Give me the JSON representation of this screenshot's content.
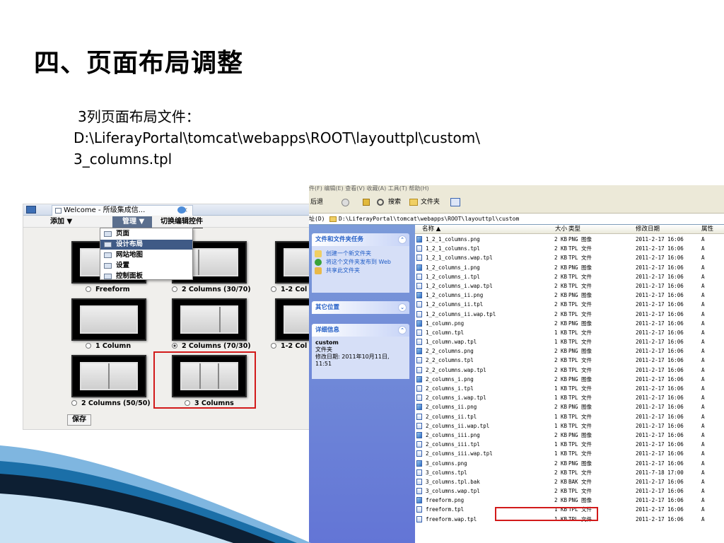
{
  "slide": {
    "title": "四、页面布局调整",
    "caption_line1": "3列页面布局文件：",
    "caption_line2": "D:\\LiferayPortal\\tomcat\\webapps\\ROOT\\layouttpl\\custom\\",
    "caption_line3": "3_columns.tpl"
  },
  "left_screenshot": {
    "tab_title": "Welcome - 所级集成信...",
    "tab_close": "×",
    "add_label": "添加 ▼",
    "manage_label": "管理 ▼",
    "toggle_label": "切换编辑控件",
    "menu_items": [
      "页面",
      "设计布局",
      "网站地图",
      "设置",
      "控制面板"
    ],
    "layouts": [
      {
        "label": "Freeform",
        "selected": false
      },
      {
        "label": "2 Columns (30/70)",
        "selected": false
      },
      {
        "label": "1-2 Col",
        "selected": false
      },
      {
        "label": "1 Column",
        "selected": false
      },
      {
        "label": "2 Columns (70/30)",
        "selected": true
      },
      {
        "label": "1-2 Col",
        "selected": false
      },
      {
        "label": "2 Columns (50/50)",
        "selected": false
      },
      {
        "label": "3 Columns",
        "selected": false
      }
    ],
    "save_label": "保存"
  },
  "explorer": {
    "menubar": "件(F)   编辑(E)   查看(V)   收藏(A)   工具(T)   帮助(H)",
    "back_label": "后退",
    "search_label": "搜索",
    "folders_label": "文件夹",
    "address_prefix": "址(D)",
    "address": "D:\\LiferayPortal\\tomcat\\webapps\\ROOT\\layouttpl\\custom",
    "tasks_header": "文件和文件夹任务",
    "tasks": [
      "创建一个新文件夹",
      "将这个文件夹发布到 Web",
      "共享此文件夹"
    ],
    "other_places_header": "其它位置",
    "details_header": "详细信息",
    "details_name": "custom",
    "details_type": "文件夹",
    "details_modified": "修改日期: 2011年10月11日, 11:51",
    "columns": {
      "name": "名称 ▲",
      "size": "大小",
      "type": "类型",
      "date": "修改日期",
      "attr": "属性"
    },
    "files": [
      {
        "name": "1_2_1_columns.png",
        "size": "2 KB",
        "type": "PNG 图像",
        "date": "2011-2-17 16:06",
        "attr": "A"
      },
      {
        "name": "1_2_1_columns.tpl",
        "size": "2 KB",
        "type": "TPL 文件",
        "date": "2011-2-17 16:06",
        "attr": "A"
      },
      {
        "name": "1_2_1_columns.wap.tpl",
        "size": "2 KB",
        "type": "TPL 文件",
        "date": "2011-2-17 16:06",
        "attr": "A"
      },
      {
        "name": "1_2_columns_i.png",
        "size": "2 KB",
        "type": "PNG 图像",
        "date": "2011-2-17 16:06",
        "attr": "A"
      },
      {
        "name": "1_2_columns_i.tpl",
        "size": "2 KB",
        "type": "TPL 文件",
        "date": "2011-2-17 16:06",
        "attr": "A"
      },
      {
        "name": "1_2_columns_i.wap.tpl",
        "size": "2 KB",
        "type": "TPL 文件",
        "date": "2011-2-17 16:06",
        "attr": "A"
      },
      {
        "name": "1_2_columns_ii.png",
        "size": "2 KB",
        "type": "PNG 图像",
        "date": "2011-2-17 16:06",
        "attr": "A"
      },
      {
        "name": "1_2_columns_ii.tpl",
        "size": "2 KB",
        "type": "TPL 文件",
        "date": "2011-2-17 16:06",
        "attr": "A"
      },
      {
        "name": "1_2_columns_ii.wap.tpl",
        "size": "2 KB",
        "type": "TPL 文件",
        "date": "2011-2-17 16:06",
        "attr": "A"
      },
      {
        "name": "1_column.png",
        "size": "2 KB",
        "type": "PNG 图像",
        "date": "2011-2-17 16:06",
        "attr": "A"
      },
      {
        "name": "1_column.tpl",
        "size": "1 KB",
        "type": "TPL 文件",
        "date": "2011-2-17 16:06",
        "attr": "A"
      },
      {
        "name": "1_column.wap.tpl",
        "size": "1 KB",
        "type": "TPL 文件",
        "date": "2011-2-17 16:06",
        "attr": "A"
      },
      {
        "name": "2_2_columns.png",
        "size": "2 KB",
        "type": "PNG 图像",
        "date": "2011-2-17 16:06",
        "attr": "A"
      },
      {
        "name": "2_2_columns.tpl",
        "size": "2 KB",
        "type": "TPL 文件",
        "date": "2011-2-17 16:06",
        "attr": "A"
      },
      {
        "name": "2_2_columns.wap.tpl",
        "size": "2 KB",
        "type": "TPL 文件",
        "date": "2011-2-17 16:06",
        "attr": "A"
      },
      {
        "name": "2_columns_i.png",
        "size": "2 KB",
        "type": "PNG 图像",
        "date": "2011-2-17 16:06",
        "attr": "A"
      },
      {
        "name": "2_columns_i.tpl",
        "size": "1 KB",
        "type": "TPL 文件",
        "date": "2011-2-17 16:06",
        "attr": "A"
      },
      {
        "name": "2_columns_i.wap.tpl",
        "size": "1 KB",
        "type": "TPL 文件",
        "date": "2011-2-17 16:06",
        "attr": "A"
      },
      {
        "name": "2_columns_ii.png",
        "size": "2 KB",
        "type": "PNG 图像",
        "date": "2011-2-17 16:06",
        "attr": "A"
      },
      {
        "name": "2_columns_ii.tpl",
        "size": "1 KB",
        "type": "TPL 文件",
        "date": "2011-2-17 16:06",
        "attr": "A"
      },
      {
        "name": "2_columns_ii.wap.tpl",
        "size": "1 KB",
        "type": "TPL 文件",
        "date": "2011-2-17 16:06",
        "attr": "A"
      },
      {
        "name": "2_columns_iii.png",
        "size": "2 KB",
        "type": "PNG 图像",
        "date": "2011-2-17 16:06",
        "attr": "A"
      },
      {
        "name": "2_columns_iii.tpl",
        "size": "1 KB",
        "type": "TPL 文件",
        "date": "2011-2-17 16:06",
        "attr": "A"
      },
      {
        "name": "2_columns_iii.wap.tpl",
        "size": "1 KB",
        "type": "TPL 文件",
        "date": "2011-2-17 16:06",
        "attr": "A"
      },
      {
        "name": "3_columns.png",
        "size": "2 KB",
        "type": "PNG 图像",
        "date": "2011-2-17 16:06",
        "attr": "A"
      },
      {
        "name": "3_columns.tpl",
        "size": "2 KB",
        "type": "TPL 文件",
        "date": "2011-7-18 17:00",
        "attr": "A"
      },
      {
        "name": "3_columns.tpl.bak",
        "size": "2 KB",
        "type": "BAK 文件",
        "date": "2011-2-17 16:06",
        "attr": "A"
      },
      {
        "name": "3_columns.wap.tpl",
        "size": "2 KB",
        "type": "TPL 文件",
        "date": "2011-2-17 16:06",
        "attr": "A"
      },
      {
        "name": "freeform.png",
        "size": "2 KB",
        "type": "PNG 图像",
        "date": "2011-2-17 16:06",
        "attr": "A"
      },
      {
        "name": "freeform.tpl",
        "size": "1 KB",
        "type": "TPL 文件",
        "date": "2011-2-17 16:06",
        "attr": "A"
      },
      {
        "name": "freeform.wap.tpl",
        "size": "1 KB",
        "type": "TPL 文件",
        "date": "2011-2-17 16:06",
        "attr": "A"
      }
    ]
  },
  "colors": {
    "highlight": "#d21a1a",
    "accent": "#1b6fa8"
  }
}
